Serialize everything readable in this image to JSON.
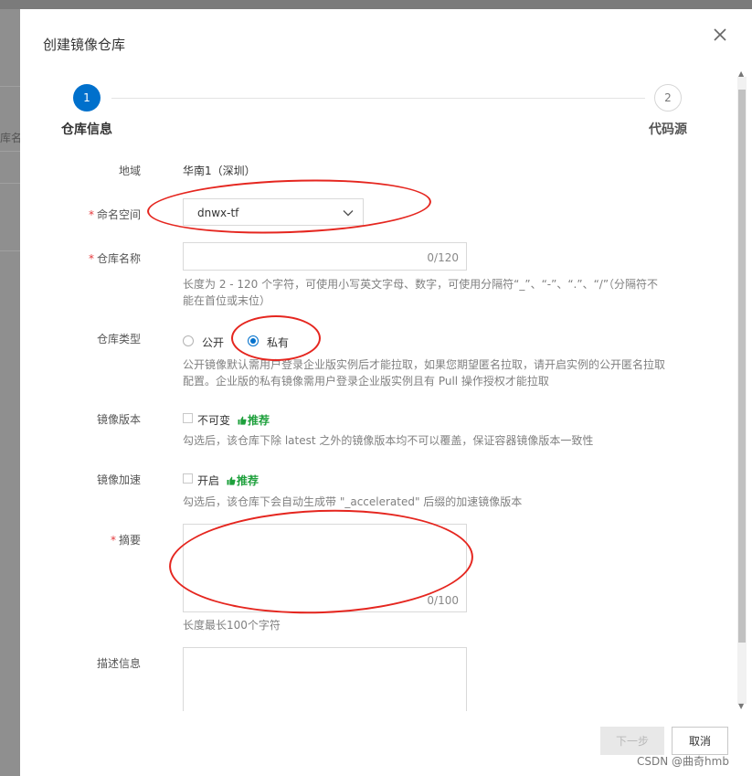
{
  "background": {
    "fragment_text": "库名称"
  },
  "modal": {
    "title": "创建镜像仓库"
  },
  "steps": [
    {
      "number": "1",
      "label": "仓库信息",
      "state": "active"
    },
    {
      "number": "2",
      "label": "代码源",
      "state": "pending"
    }
  ],
  "form": {
    "region": {
      "label": "地域",
      "value": "华南1（深圳）"
    },
    "namespace": {
      "label": "命名空间",
      "required": "*",
      "value": "dnwx-tf"
    },
    "repo_name": {
      "label": "仓库名称",
      "required": "*",
      "counter": "0/120",
      "help": "长度为 2 - 120 个字符，可使用小写英文字母、数字，可使用分隔符“_”、“-”、“.”、“/”（分隔符不能在首位或末位）"
    },
    "repo_type": {
      "label": "仓库类型",
      "options": [
        "公开",
        "私有"
      ],
      "selected": "私有",
      "help": "公开镜像默认需用户登录企业版实例后才能拉取，如果您期望匿名拉取，请开启实例的公开匿名拉取配置。企业版的私有镜像需用户登录企业版实例且有 Pull 操作授权才能拉取"
    },
    "image_version": {
      "label": "镜像版本",
      "checkbox_label": "不可变",
      "badge": "推荐",
      "help": "勾选后，该仓库下除 latest 之外的镜像版本均不可以覆盖，保证容器镜像版本一致性"
    },
    "image_accel": {
      "label": "镜像加速",
      "checkbox_label": "开启",
      "badge": "推荐",
      "help": "勾选后，该仓库下会自动生成带 \"_accelerated\" 后缀的加速镜像版本"
    },
    "summary": {
      "label": "摘要",
      "required": "*",
      "counter": "0/100",
      "help": "长度最长100个字符"
    },
    "description": {
      "label": "描述信息"
    }
  },
  "footer": {
    "next_label": "下一步",
    "cancel_label": "取消"
  },
  "watermark": "CSDN @曲奇hmb",
  "colors": {
    "primary": "#0070cc",
    "annotation": "#e5261f",
    "recommend": "#1ea03c",
    "required": "#e4393c"
  }
}
